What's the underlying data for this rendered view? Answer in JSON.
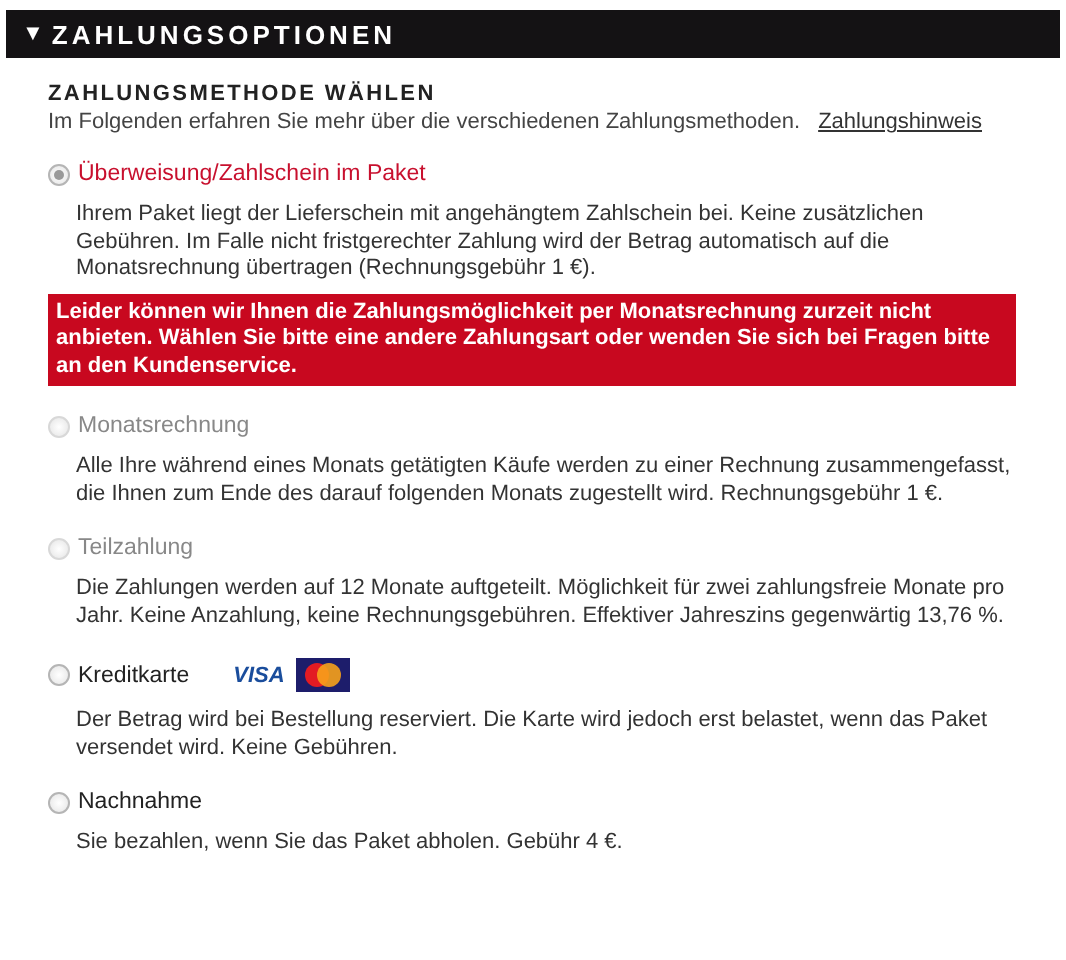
{
  "section": {
    "title": "ZAHLUNGSOPTIONEN",
    "toggle": "▼",
    "expanded": true
  },
  "heading": "ZAHLUNGSMETHODE WÄHLEN",
  "intro": "Im Folgenden erfahren Sie mehr über die verschiedenen Zahlungsmethoden.",
  "intro_link": "Zahlungshinweis",
  "options": [
    {
      "label": "Überweisung/Zahlschein im Paket",
      "selected": true,
      "disabled": false,
      "description": "Ihrem Paket liegt der Lieferschein mit angehängtem Zahlschein bei. Keine zusätzlichen Gebühren. Im Falle nicht fristgerechter Zahlung wird der Betrag automatisch auf die Monatsrechnung übertragen (Rechnungsgebühr 1 €).",
      "alert": "Leider können wir Ihnen die Zahlungsmöglichkeit per Monatsrechnung zurzeit nicht anbieten. Wählen Sie bitte eine andere Zahlungsart oder wenden Sie sich bei Fragen bitte an den Kundenservice."
    },
    {
      "label": "Monatsrechnung",
      "selected": false,
      "disabled": true,
      "description": "Alle Ihre während eines Monats getätigten Käufe werden zu einer Rechnung zusammengefasst, die Ihnen zum Ende des darauf folgenden Monats zugestellt wird. Rechnungsgebühr 1 €."
    },
    {
      "label": "Teilzahlung",
      "selected": false,
      "disabled": true,
      "description": "Die Zahlungen werden auf 12 Monate auftgeteilt. Möglichkeit für zwei zahlungsfreie Monate pro Jahr. Keine Anzahlung, keine Rechnungsgebühren. Effektiver Jahreszins gegenwärtig 13,76 %."
    },
    {
      "label": "Kreditkarte",
      "selected": false,
      "disabled": false,
      "card_logos": [
        {
          "kind": "visa",
          "text": "VISA"
        },
        {
          "kind": "mastercard"
        }
      ],
      "description": "Der Betrag wird bei Bestellung reserviert. Die Karte wird jedoch erst belastet, wenn das Paket versendet wird. Keine Gebühren."
    },
    {
      "label": "Nachnahme",
      "selected": false,
      "disabled": false,
      "description": "Sie bezahlen, wenn Sie das Paket abholen. Gebühr 4 €."
    }
  ]
}
